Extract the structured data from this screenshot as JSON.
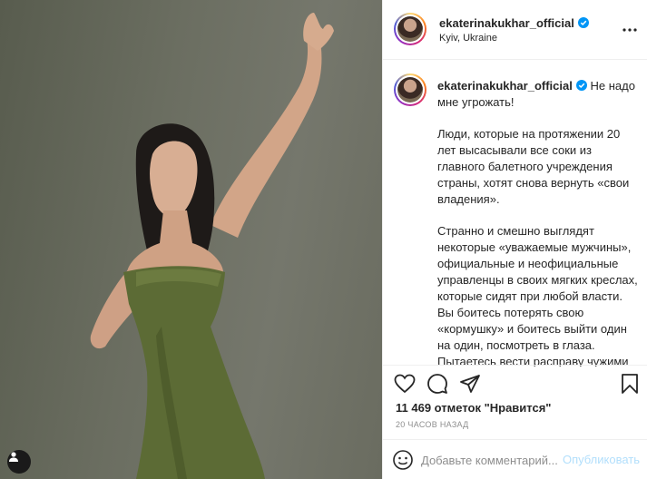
{
  "post": {
    "username": "ekaterinakukhar_official",
    "location": "Kyiv, Ukraine",
    "caption": {
      "lead": "Не надо мне угрожать!",
      "paragraphs": [
        "Люди, которые на протяжении 20 лет высасывали все соки из главного балетного учреждения страны, хотят снова вернуть «свои владения».",
        "Странно и смешно выглядят некоторые «уважаемые мужчины», официальные и неофициальные управленцы в своих мягких креслах, которые сидят при любой власти. Вы боитесь потерять свою «кормушку» и боитесь выйти один на один, посмотреть в глаза. Пытаетесь вести расправу чужими руками, поставить своего удобного человека... Это всё ожидаемо."
      ]
    },
    "likes_text": "11 469 отметок \"Нравится\"",
    "time_text": "20 часов назад"
  },
  "comment": {
    "placeholder": "Добавьте комментарий...",
    "publish_label": "Опубликовать"
  },
  "icons": {
    "verified": "verified-badge-icon",
    "more": "more-dots-icon",
    "like": "heart-icon",
    "comment": "comment-bubble-icon",
    "share": "paper-plane-icon",
    "save": "bookmark-icon",
    "emoji": "smiley-icon",
    "tag": "person-tag-icon"
  },
  "colors": {
    "verified": "#0095f6",
    "publish_disabled": "#b2dffc",
    "muted_text": "#8e8e8e",
    "dress_green": "#5c6b35"
  }
}
